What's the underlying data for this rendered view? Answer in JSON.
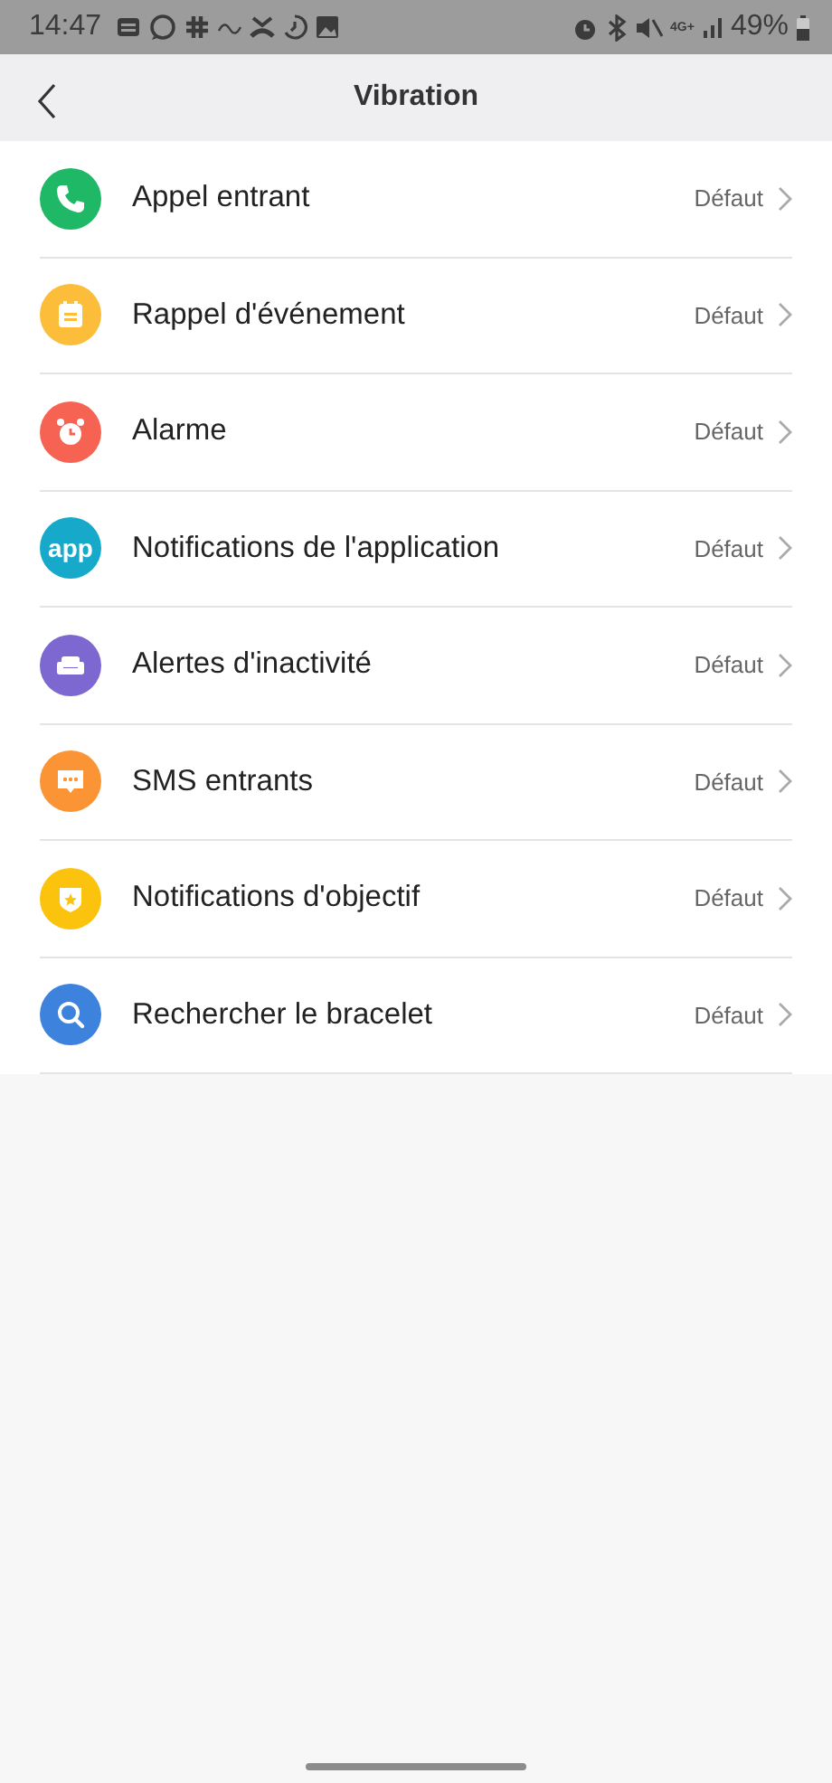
{
  "status_bar": {
    "time": "14:47",
    "network": "4G+",
    "battery": "49%"
  },
  "header": {
    "title": "Vibration"
  },
  "items": [
    {
      "label": "Appel entrant",
      "value": "Défaut",
      "kind": "phone",
      "color": "#1fb866"
    },
    {
      "label": "Rappel d'événement",
      "value": "Défaut",
      "kind": "calendar",
      "color": "#fbbd3a"
    },
    {
      "label": "Alarme",
      "value": "Défaut",
      "kind": "alarm",
      "color": "#f66353"
    },
    {
      "label": "Notifications de l'application",
      "value": "Défaut",
      "kind": "app",
      "color": "#16a9c9",
      "icon_text": "app"
    },
    {
      "label": "Alertes d'inactivité",
      "value": "Défaut",
      "kind": "sofa",
      "color": "#7d67d0"
    },
    {
      "label": "SMS entrants",
      "value": "Défaut",
      "kind": "message",
      "color": "#fb9434"
    },
    {
      "label": "Notifications d'objectif",
      "value": "Défaut",
      "kind": "badge",
      "color": "#fbc30d"
    },
    {
      "label": "Rechercher le bracelet",
      "value": "Défaut",
      "kind": "search",
      "color": "#3d82dc"
    }
  ]
}
